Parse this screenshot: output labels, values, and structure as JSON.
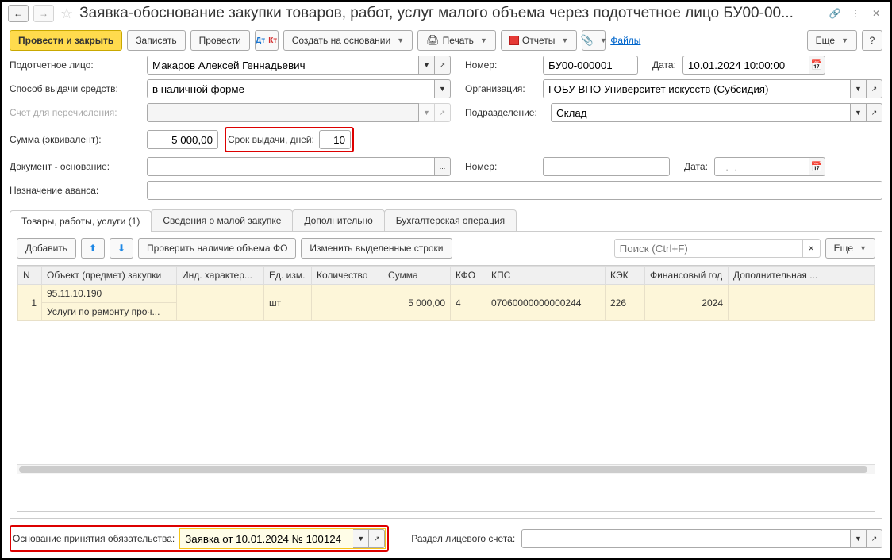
{
  "title": "Заявка-обоснование закупки товаров, работ, услуг малого объема через подотчетное лицо БУ00-00...",
  "toolbar": {
    "submit_close": "Провести и закрыть",
    "save": "Записать",
    "submit": "Провести",
    "create_based": "Создать на основании",
    "print": "Печать",
    "reports": "Отчеты",
    "files": "Файлы",
    "more": "Еще",
    "help": "?"
  },
  "form": {
    "accountable_label": "Подотчетное лицо:",
    "accountable_value": "Макаров Алексей Геннадьевич",
    "number_label": "Номер:",
    "number_value": "БУ00-000001",
    "date_label": "Дата:",
    "date_value": "10.01.2024 10:00:00",
    "method_label": "Способ выдачи средств:",
    "method_value": "в наличной форме",
    "org_label": "Организация:",
    "org_value": "ГОБУ ВПО Университет искусств (Субсидия)",
    "account_label": "Счет для перечисления:",
    "dept_label": "Подразделение:",
    "dept_value": "Склад",
    "sum_label": "Сумма (эквивалент):",
    "sum_value": "5 000,00",
    "period_label": "Срок выдачи, дней:",
    "period_value": "10",
    "docbase_label": "Документ - основание:",
    "docnum_label": "Номер:",
    "docdate_label": "Дата:",
    "docdate_value": "  .  .    ",
    "advance_label": "Назначение аванса:"
  },
  "tabs": {
    "goods": "Товары, работы, услуги (1)",
    "purchase_info": "Сведения о малой закупке",
    "additional": "Дополнительно",
    "accounting": "Бухгалтерская операция"
  },
  "tab_toolbar": {
    "add": "Добавить",
    "check": "Проверить наличие объема ФО",
    "edit_rows": "Изменить выделенные строки",
    "search_ph": "Поиск (Ctrl+F)",
    "more": "Еще"
  },
  "grid": {
    "cols": {
      "n": "N",
      "object": "Объект (предмет) закупки",
      "ind": "Инд. характер...",
      "unit": "Ед. изм.",
      "qty": "Количество",
      "sum": "Сумма",
      "kfo": "КФО",
      "kps": "КПС",
      "kek": "КЭК",
      "finyear": "Финансовый год",
      "extra": "Дополнительная ..."
    },
    "row": {
      "n": "1",
      "object1": "95.11.10.190",
      "object2": "Услуги по ремонту проч...",
      "unit": "шт",
      "sum": "5 000,00",
      "kfo": "4",
      "kps": "07060000000000244",
      "kek": "226",
      "finyear": "2024"
    }
  },
  "footer": {
    "basis_label": "Основание принятия обязательства:",
    "basis_value": "Заявка от 10.01.2024 № 100124",
    "account_section_label": "Раздел лицевого счета:"
  }
}
